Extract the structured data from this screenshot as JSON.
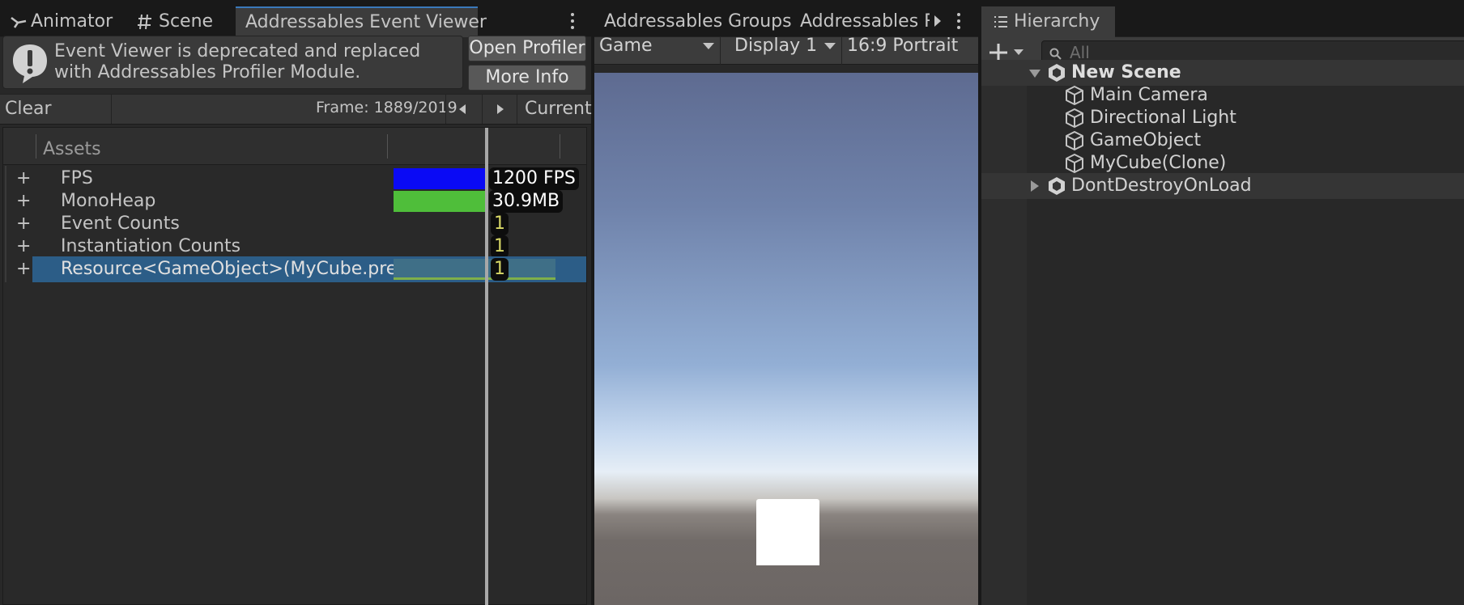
{
  "left": {
    "tabs": [
      {
        "label": "Animator",
        "icon": "animator-icon"
      },
      {
        "label": "Scene",
        "icon": "grid-icon"
      },
      {
        "label": "Addressables Event Viewer",
        "active": true
      }
    ],
    "notice": "Event Viewer is deprecated and replaced with Addressables Profiler Module.",
    "open_profiler_label": "Open Profiler",
    "more_info_label": "More Info",
    "clear_events_label": "Clear Events",
    "frame_text": "Frame: 1889/2019",
    "current_label": "Current",
    "column_header": "Assets",
    "rows": [
      {
        "expander": "+",
        "label": "FPS",
        "value": "1200 FPS",
        "bar_color": "#0a0af5"
      },
      {
        "expander": "+",
        "label": "MonoHeap",
        "value": "30.9MB",
        "bar_color": "#4fbe3a"
      },
      {
        "expander": "+",
        "label": "Event Counts",
        "value": "1"
      },
      {
        "expander": "+",
        "label": "Instantiation Counts",
        "value": "1"
      },
      {
        "expander": "+",
        "label": "Resource<GameObject>(MyCube.prefab)",
        "value": "1",
        "selected": true
      }
    ]
  },
  "middle": {
    "tabs": [
      {
        "label": "Addressables Groups"
      },
      {
        "label": "Addressables Re"
      }
    ],
    "game_dropdown": "Game",
    "display_dropdown": "Display 1",
    "aspect_dropdown": "16:9 Portrait"
  },
  "right": {
    "tab_label": "Hierarchy",
    "search_placeholder": "All",
    "scenes": [
      {
        "name": "New Scene",
        "expanded": true,
        "children": [
          "Main Camera",
          "Directional Light",
          "GameObject",
          "MyCube(Clone)"
        ]
      },
      {
        "name": "DontDestroyOnLoad",
        "expanded": false,
        "children": []
      }
    ]
  },
  "colors": {
    "accent": "#3a79bb",
    "selection": "#2c5d87",
    "panel_bg": "#282828",
    "fps_bar": "#0a0af5",
    "heap_bar": "#4fbe3a"
  }
}
